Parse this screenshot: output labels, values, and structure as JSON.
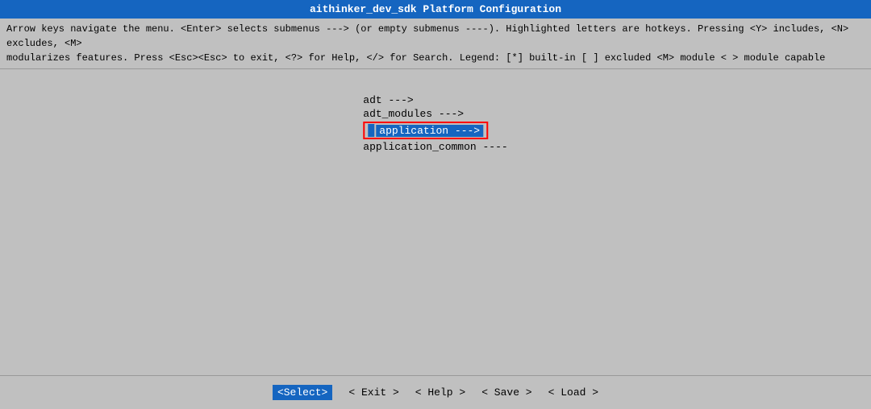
{
  "titleBar": {
    "text": "aithinker_dev_sdk Platform Configuration"
  },
  "helpText": {
    "line1": "Arrow keys navigate the menu.  <Enter> selects submenus ---> (or empty submenus ----).  Highlighted letters are hotkeys.  Pressing <Y> includes, <N> excludes, <M>",
    "line2": "modularizes features.  Press <Esc><Esc> to exit, <?> for Help, </> for Search.  Legend: [*] built-in  [ ] excluded  <M> module  < > module capable"
  },
  "menuItems": [
    {
      "label": "adt  --->",
      "selected": false
    },
    {
      "label": "adt_modules  --->",
      "selected": false
    },
    {
      "label": "application  --->",
      "selected": true
    },
    {
      "label": "application_common  ----",
      "selected": false
    }
  ],
  "bottomBar": {
    "select": "<Select>",
    "exit": "< Exit >",
    "help": "< Help >",
    "save": "< Save >",
    "load": "< Load >"
  }
}
